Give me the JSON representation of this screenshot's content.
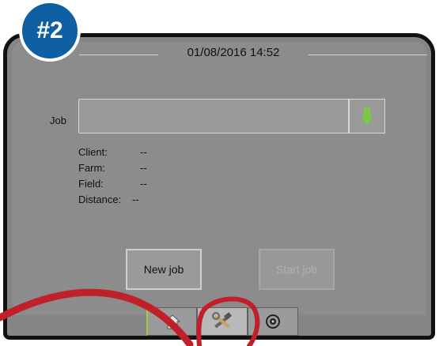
{
  "badge": {
    "label": "#2",
    "color": "#0f5fa3"
  },
  "header": {
    "datetime": "01/08/2016 14:52"
  },
  "job": {
    "label": "Job",
    "value": "",
    "dropdown_icon": "green-down-arrow-icon"
  },
  "details": [
    {
      "key": "Client:",
      "value": "--"
    },
    {
      "key": "Farm:",
      "value": "--"
    },
    {
      "key": "Field:",
      "value": "--"
    },
    {
      "key": "Distance:",
      "value": "--"
    }
  ],
  "buttons": {
    "new_job": "New job",
    "start_job": "Start job"
  },
  "tabs": [
    {
      "icon": "home-icon",
      "active": false
    },
    {
      "icon": "tools-icon",
      "active": true
    },
    {
      "icon": "target-icon",
      "active": false
    }
  ],
  "colors": {
    "highlight_circle": "#c0202a",
    "arrow_green": "#7ac943"
  }
}
